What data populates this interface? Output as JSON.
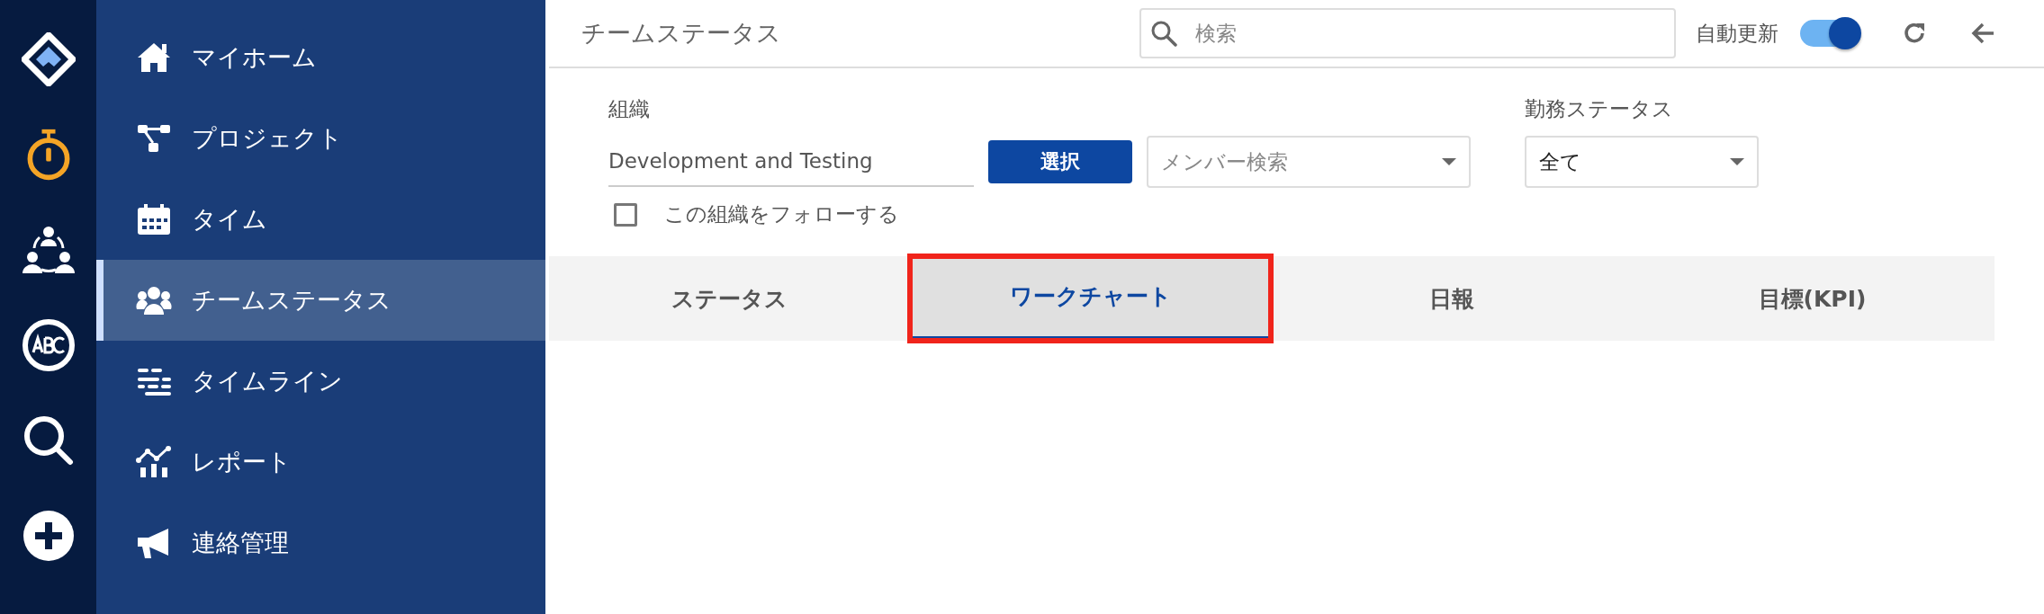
{
  "rail": [
    {
      "kind": "logo"
    },
    {
      "kind": "timer"
    },
    {
      "kind": "team"
    },
    {
      "kind": "abc"
    },
    {
      "kind": "search"
    },
    {
      "kind": "add"
    }
  ],
  "sidebar": {
    "items": [
      {
        "label": "マイホーム",
        "kind": "home",
        "selected": false
      },
      {
        "label": "プロジェクト",
        "kind": "project",
        "selected": false
      },
      {
        "label": "タイム",
        "kind": "calendar",
        "selected": false
      },
      {
        "label": "チームステータス",
        "kind": "people",
        "selected": true
      },
      {
        "label": "タイムライン",
        "kind": "timeline",
        "selected": false
      },
      {
        "label": "レポート",
        "kind": "report",
        "selected": false
      },
      {
        "label": "連絡管理",
        "kind": "megaphone",
        "selected": false
      }
    ]
  },
  "header": {
    "title": "チームステータス",
    "search": {
      "placeholder": "検索"
    },
    "auto_refresh": {
      "label": "自動更新",
      "on": true
    }
  },
  "filters": {
    "organization": {
      "label": "組織",
      "value": "Development and Testing",
      "button": "選択"
    },
    "member_search": {
      "placeholder": "メンバー検索"
    },
    "work_status": {
      "label": "勤務ステータス",
      "value": "全て"
    },
    "follow": {
      "label": "この組織をフォローする",
      "checked": false
    }
  },
  "tabs": [
    {
      "label": "ステータス",
      "selected": false,
      "highlighted": false
    },
    {
      "label": "ワークチャート",
      "selected": true,
      "highlighted": true
    },
    {
      "label": "日報",
      "selected": false,
      "highlighted": false
    },
    {
      "label": "目標(KPI)",
      "selected": false,
      "highlighted": false
    }
  ]
}
